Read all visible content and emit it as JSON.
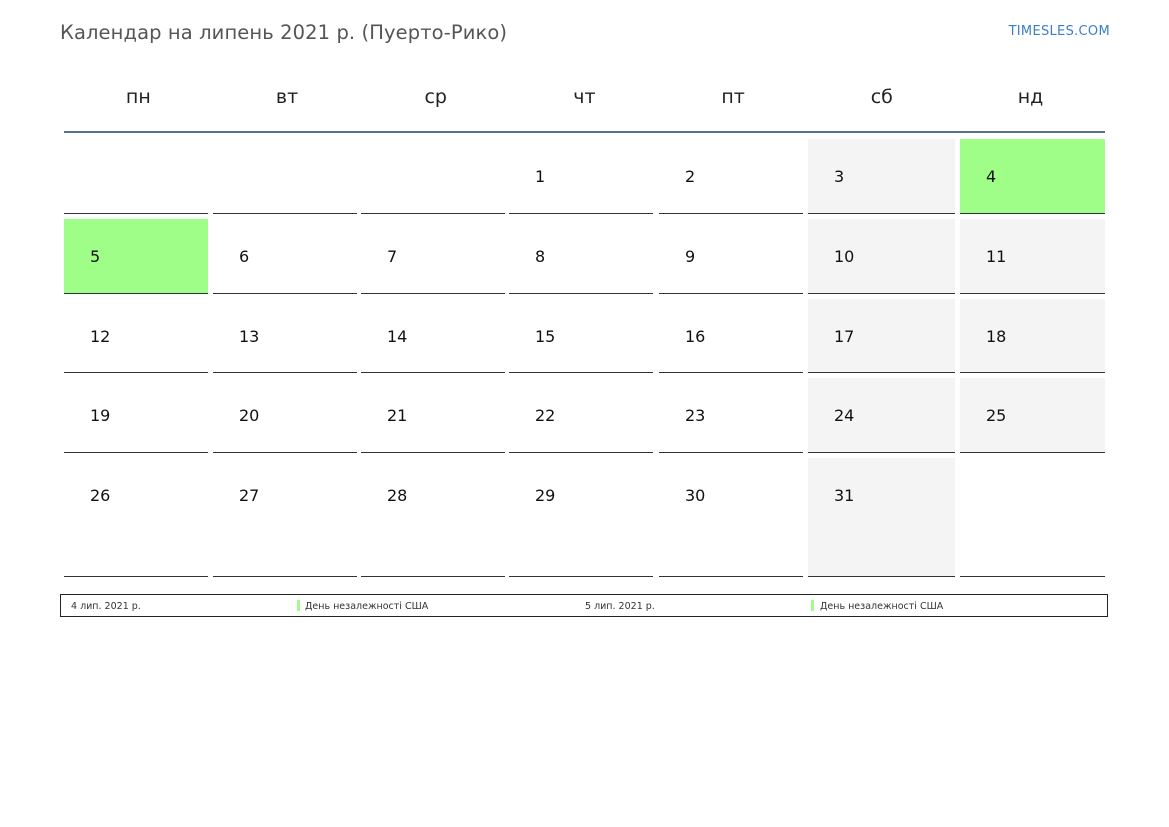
{
  "header": {
    "title": "Календар на липень 2021 р. (Пуерто-Рико)",
    "brand": "TIMESLES.COM"
  },
  "weekdays": [
    "пн",
    "вт",
    "ср",
    "чт",
    "пт",
    "сб",
    "нд"
  ],
  "weeks": [
    [
      "",
      "",
      "",
      "1",
      "2",
      "3",
      "4"
    ],
    [
      "5",
      "6",
      "7",
      "8",
      "9",
      "10",
      "11"
    ],
    [
      "12",
      "13",
      "14",
      "15",
      "16",
      "17",
      "18"
    ],
    [
      "19",
      "20",
      "21",
      "22",
      "23",
      "24",
      "25"
    ],
    [
      "26",
      "27",
      "28",
      "29",
      "30",
      "31",
      ""
    ]
  ],
  "holiday_days": [
    "4",
    "5"
  ],
  "colors": {
    "holiday": "#9efe88",
    "weekend": "#f4f4f4",
    "header_line": "#5b6f8f",
    "brand": "#3a7fc4"
  },
  "legend": [
    {
      "date": "4 лип. 2021 р.",
      "name": "День незалежності США"
    },
    {
      "date": "5 лип. 2021 р.",
      "name": "День незалежності США"
    }
  ]
}
